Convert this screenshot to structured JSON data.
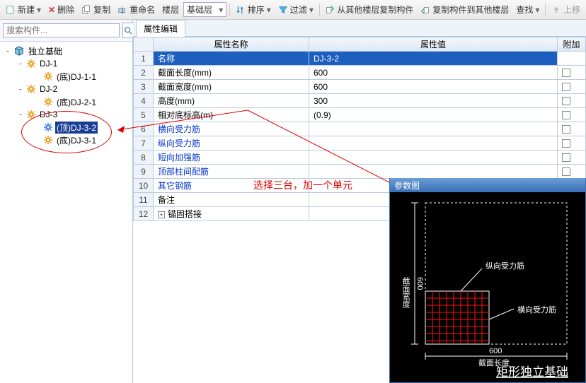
{
  "toolbar": {
    "new_label": "新建",
    "delete_label": "删除",
    "copy_label": "复制",
    "rename_label": "重命名",
    "floor_label": "楼层",
    "base_label": "基础层",
    "sort_label": "排序",
    "filter_label": "过滤",
    "copy_from_label": "从其他楼层复制构件",
    "copy_to_label": "复制构件到其他楼层",
    "find_label": "查找",
    "moveup_label": "上移"
  },
  "search": {
    "placeholder": "搜索构件..."
  },
  "tree": {
    "root": "独立基础",
    "items": [
      {
        "label": "DJ-1",
        "indent": 24,
        "expand": "-",
        "gear": "orange"
      },
      {
        "label": "(底)DJ-1-1",
        "indent": 48,
        "expand": "",
        "gear": "orange"
      },
      {
        "label": "DJ-2",
        "indent": 24,
        "expand": "-",
        "gear": "orange"
      },
      {
        "label": "(底)DJ-2-1",
        "indent": 48,
        "expand": "",
        "gear": "orange"
      },
      {
        "label": "DJ-3",
        "indent": 24,
        "expand": "-",
        "gear": "orange"
      },
      {
        "label": "(顶)DJ-3-2",
        "indent": 48,
        "expand": "",
        "gear": "blue",
        "selected": true
      },
      {
        "label": "(底)DJ-3-1",
        "indent": 48,
        "expand": "",
        "gear": "orange"
      }
    ]
  },
  "tabs": {
    "prop_edit": "属性编辑"
  },
  "table": {
    "col_name": "属性名称",
    "col_value": "属性值",
    "col_extra": "附加",
    "rows": [
      {
        "n": "1",
        "name": "名称",
        "value": "DJ-3-2",
        "hl": true,
        "chk": false
      },
      {
        "n": "2",
        "name": "截面长度(mm)",
        "value": "600",
        "chk": true
      },
      {
        "n": "3",
        "name": "截面宽度(mm)",
        "value": "600",
        "chk": true
      },
      {
        "n": "4",
        "name": "高度(mm)",
        "value": "300",
        "chk": true
      },
      {
        "n": "5",
        "name": "相对底标高(m)",
        "value": "(0.9)",
        "chk": true
      },
      {
        "n": "6",
        "name": "横向受力筋",
        "value": "",
        "link": true,
        "chk": true
      },
      {
        "n": "7",
        "name": "纵向受力筋",
        "value": "",
        "link": true,
        "chk": true
      },
      {
        "n": "8",
        "name": "短向加强筋",
        "value": "",
        "link": true,
        "chk": true
      },
      {
        "n": "9",
        "name": "顶部柱间配筋",
        "value": "",
        "link": true,
        "chk": true
      },
      {
        "n": "10",
        "name": "其它钢筋",
        "value": "",
        "link": true,
        "chk": false
      },
      {
        "n": "11",
        "name": "备注",
        "value": "",
        "chk": true
      },
      {
        "n": "12",
        "name": "锚固搭接",
        "value": "",
        "plus": true,
        "chk": false
      }
    ]
  },
  "annotation": {
    "text": "选择三台，加一个单元"
  },
  "diagram": {
    "title": "参数图",
    "label_width": "截面宽度",
    "label_length": "截面长度",
    "label_vrebar": "纵向受力筋",
    "label_hrebar": "横向受力筋",
    "dim_w": "600",
    "dim_l": "600",
    "caption": "矩形独立基础"
  }
}
